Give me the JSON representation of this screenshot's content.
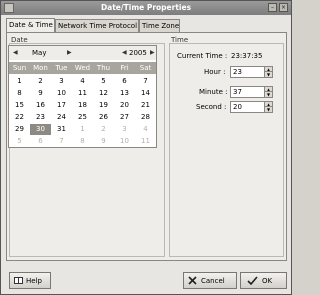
{
  "window": {
    "title": "Date/Time Properties"
  },
  "tabs": [
    {
      "label": "Date & Time",
      "mnemonic_index": 7
    },
    {
      "label": "Network Time Protocol"
    },
    {
      "label": "Time Zone"
    }
  ],
  "date_group": {
    "label": "Date",
    "month": "May",
    "year": "2005",
    "weekdays": [
      "Sun",
      "Mon",
      "Tue",
      "Wed",
      "Thu",
      "Fri",
      "Sat"
    ],
    "weeks": [
      [
        "1",
        "2",
        "3",
        "4",
        "5",
        "6",
        "7"
      ],
      [
        "8",
        "9",
        "10",
        "11",
        "12",
        "13",
        "14"
      ],
      [
        "15",
        "16",
        "17",
        "18",
        "19",
        "20",
        "21"
      ],
      [
        "22",
        "23",
        "24",
        "25",
        "26",
        "27",
        "28"
      ],
      [
        "29",
        "30",
        "31",
        "1",
        "2",
        "3",
        "4"
      ],
      [
        "5",
        "6",
        "7",
        "8",
        "9",
        "10",
        "11"
      ]
    ],
    "selected_day": "30"
  },
  "time_group": {
    "label": "Time",
    "current_time_label": "Current Time :",
    "current_time_value": "23:37:35",
    "hour_label": "Hour :",
    "hour_value": "23",
    "minute_label": "Minute :",
    "minute_value": "37",
    "second_label": "Second :",
    "second_value": "20"
  },
  "buttons": {
    "help": "Help",
    "cancel": "Cancel",
    "ok": "OK"
  }
}
